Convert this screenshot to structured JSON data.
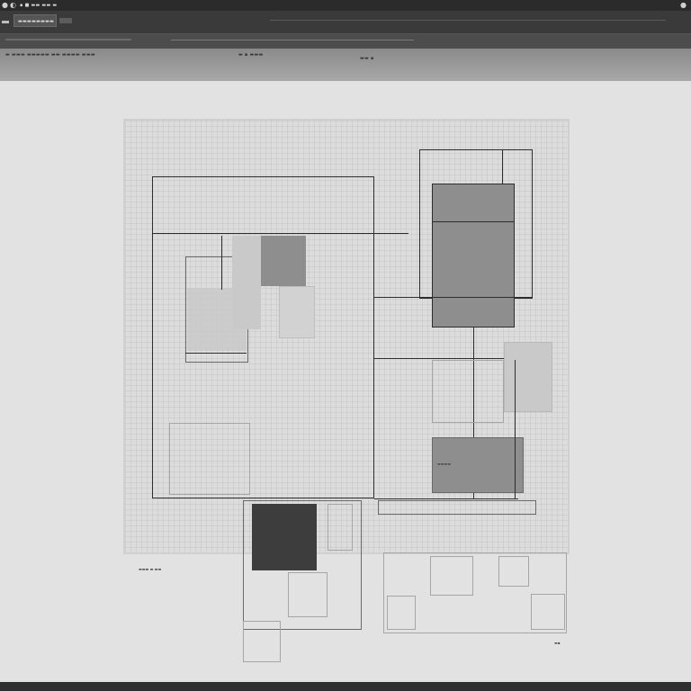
{
  "window": {
    "menu_text": "▪ ■ ▬▬ ▬▬ ▬",
    "toolbar_label": "▬▬▬▬▬▬▬▬",
    "status_left": "▬ ▬▬▬ ▬▬▬▬▬ ▬▬ ▬▬▬▬ ▬▬▬",
    "status_mid": "▬ ▪ ▬▬▬",
    "status_right": "▬▬ ▪"
  },
  "drawing": {
    "note_right": "▬▬▬▬",
    "note_bottom_left": "▬▬▬ ▬ ▬▬",
    "note_bottom_right": "▬▪"
  },
  "colors": {
    "chrome_dark": "#2b2b2b",
    "chrome_mid": "#4c4c4c",
    "canvas": "#e2e2e2",
    "sheet": "#dcdcdc",
    "block_dark": "#3d3d3d",
    "block_mid": "#8e8e8e"
  }
}
